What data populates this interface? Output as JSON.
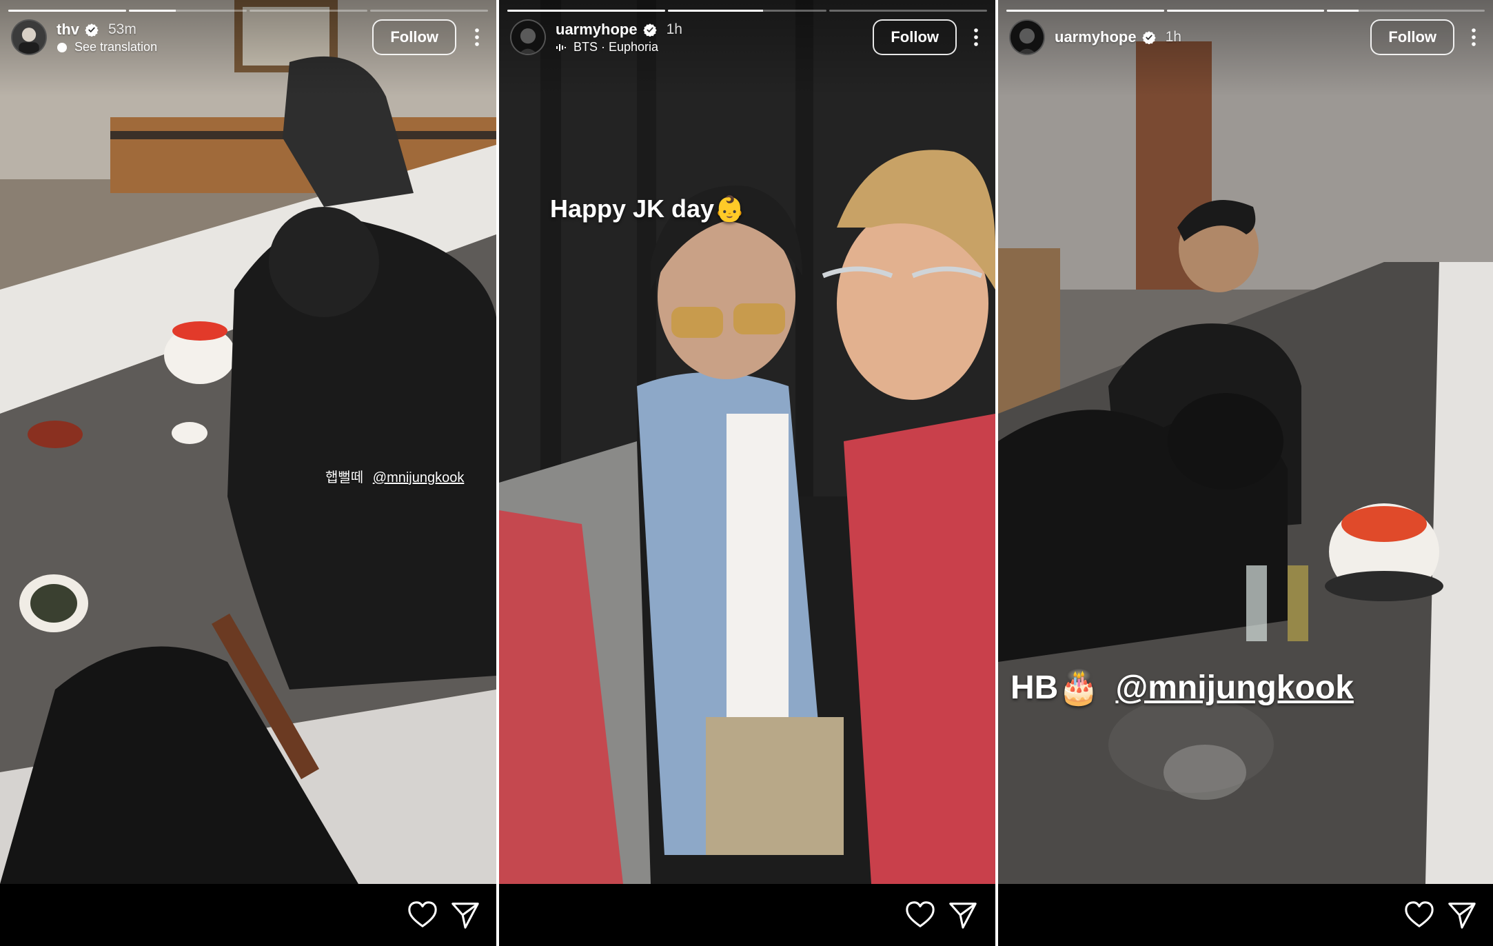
{
  "stories": [
    {
      "username": "thv",
      "verified": true,
      "time": "53m",
      "subtitle": "See translation",
      "subtitle_icon": "translate-icon",
      "follow_label": "Follow",
      "progress": [
        1,
        0.4,
        0,
        0
      ],
      "overlay": {
        "prefix": "햅뻘떼",
        "mention": "@mnijungkook"
      }
    },
    {
      "username": "uarmyhope",
      "verified": true,
      "time": "1h",
      "subtitle": "BTS · Euphoria",
      "subtitle_icon": "music-icon",
      "follow_label": "Follow",
      "progress": [
        1,
        0.6,
        0
      ],
      "overlay": {
        "caption": "Happy JK day👶"
      }
    },
    {
      "username": "uarmyhope",
      "verified": true,
      "time": "1h",
      "follow_label": "Follow",
      "progress": [
        1,
        1,
        0.2
      ],
      "overlay": {
        "prefix": "HB🎂",
        "mention": "@mnijungkook"
      }
    }
  ],
  "footer": {
    "like_icon": "heart-icon",
    "share_icon": "send-icon"
  },
  "colors": {
    "background": "#000000",
    "text": "#ffffff",
    "verified": "#ffffff"
  }
}
